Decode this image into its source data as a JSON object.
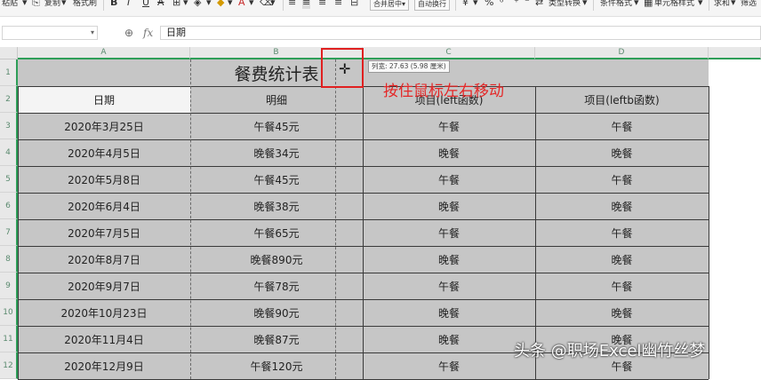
{
  "toolbar": {
    "paste": "粘贴",
    "copy": "复制",
    "format_painter": "格式刷",
    "bold": "B",
    "italic": "I",
    "underline": "U",
    "strike": "A",
    "merge_center": "合并居中",
    "wrap_text": "自动换行",
    "currency": "¥",
    "percent": "%",
    "type_convert": "类型转换",
    "conditional_format": "条件格式",
    "cell_style": "单元格样式",
    "sum": "求和",
    "filter": "筛选"
  },
  "formula_bar": {
    "name_box": "",
    "fx": "fx",
    "content": "日期"
  },
  "columns": [
    "A",
    "B",
    "C",
    "D"
  ],
  "rows": [
    "1",
    "2",
    "3",
    "4",
    "5",
    "6",
    "7",
    "8",
    "9",
    "10",
    "11",
    "12"
  ],
  "sheet": {
    "title": "餐费统计表",
    "headers": [
      "日期",
      "明细",
      "项目(left函数)",
      "项目(leftb函数)"
    ],
    "data": [
      [
        "2020年3月25日",
        "午餐45元",
        "午餐",
        "午餐"
      ],
      [
        "2020年4月5日",
        "晚餐34元",
        "晚餐",
        "晚餐"
      ],
      [
        "2020年5月8日",
        "午餐45元",
        "午餐",
        "午餐"
      ],
      [
        "2020年6月4日",
        "晚餐38元",
        "晚餐",
        "晚餐"
      ],
      [
        "2020年7月5日",
        "午餐65元",
        "午餐",
        "午餐"
      ],
      [
        "2020年8月7日",
        "晚餐890元",
        "晚餐",
        "晚餐"
      ],
      [
        "2020年9月7日",
        "午餐78元",
        "午餐",
        "午餐"
      ],
      [
        "2020年10月23日",
        "晚餐90元",
        "晚餐",
        "晚餐"
      ],
      [
        "2020年11月4日",
        "晚餐87元",
        "晚餐",
        "晚餐"
      ],
      [
        "2020年12月9日",
        "午餐120元",
        "午餐",
        "午餐"
      ]
    ]
  },
  "tooltip": "列宽: 27.63 (5.98 厘米)",
  "annotation": "按住鼠标左右移动",
  "watermark": "头条 @职场Excel幽竹丝梦",
  "colors": {
    "selection": "#c6c6c6",
    "header_green": "#2e9e58",
    "annotation_red": "#e52626"
  },
  "icons": {
    "zoom": "zoom-icon",
    "fx": "fx-icon",
    "cursor": "column-resize-cursor-icon"
  }
}
